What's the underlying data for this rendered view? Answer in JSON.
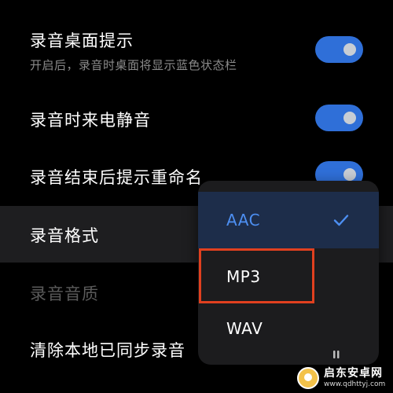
{
  "settings": {
    "items": [
      {
        "title": "录音桌面提示",
        "subtitle": "开启后，录音时桌面将显示蓝色状态栏",
        "toggle": true
      },
      {
        "title": "录音时来电静音",
        "toggle": true
      },
      {
        "title": "录音结束后提示重命名",
        "toggle": true
      },
      {
        "title": "录音格式"
      },
      {
        "title": "录音音质",
        "disabled": true
      },
      {
        "title": "清除本地已同步录音"
      }
    ]
  },
  "format_popup": {
    "options": [
      "AAC",
      "MP3",
      "WAV"
    ],
    "selected": "AAC",
    "highlighted": "MP3"
  },
  "colors": {
    "accent": "#2f6fd8",
    "selected_text": "#4d8ff2",
    "annotation_box": "#e0401f"
  },
  "watermark": {
    "name": "启东安卓网",
    "url": "www.qdhttyj.com"
  }
}
